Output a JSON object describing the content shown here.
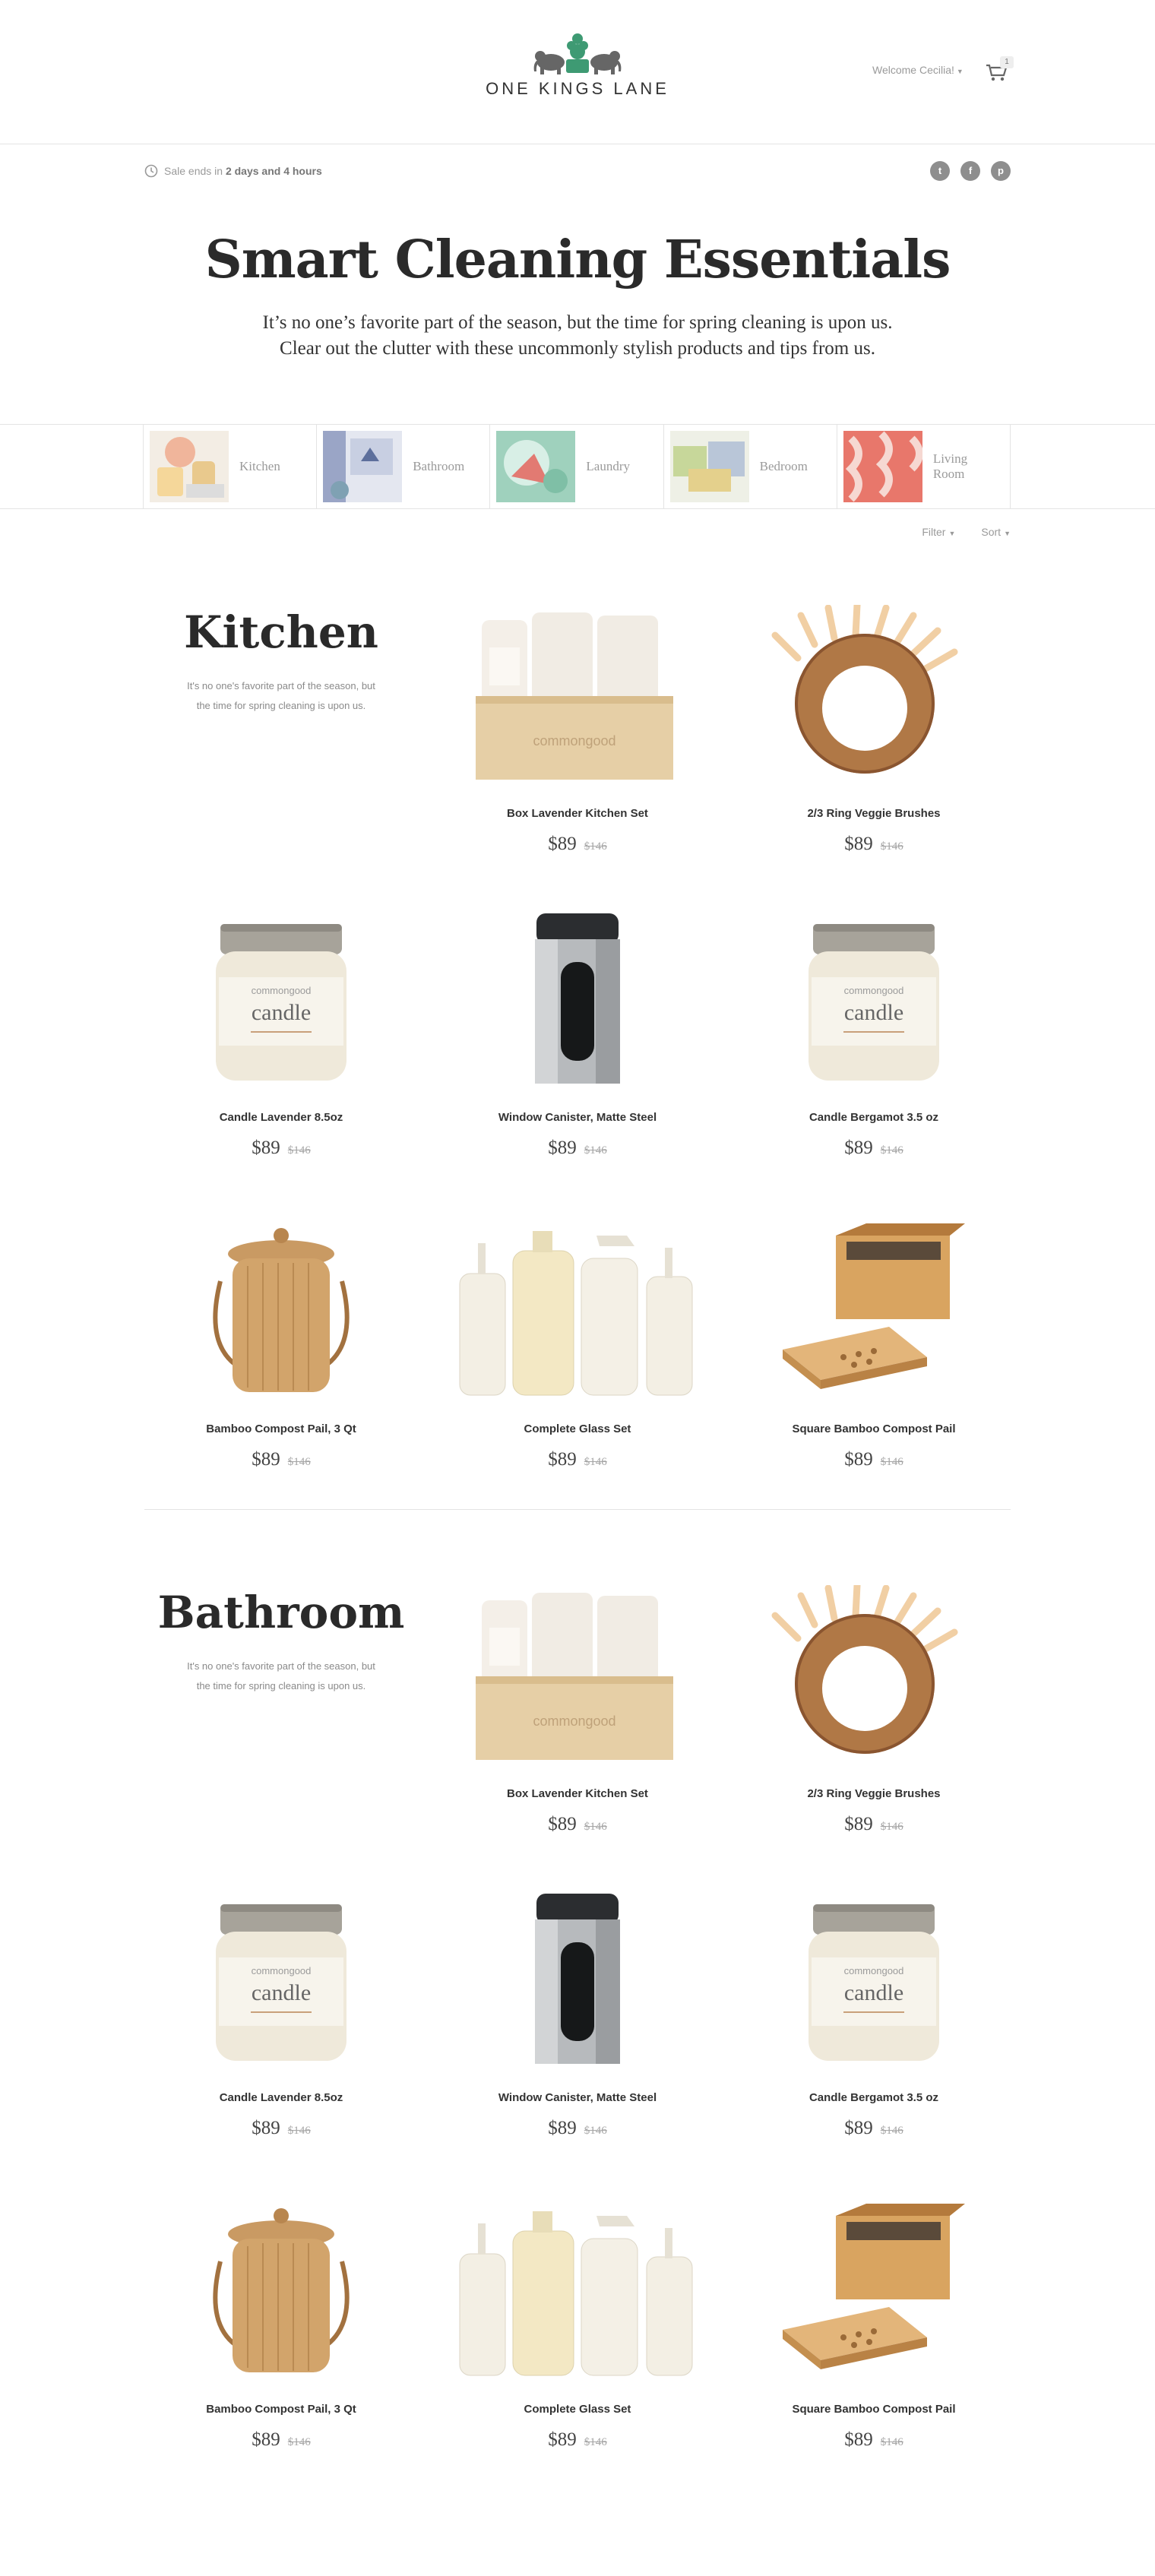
{
  "brand": {
    "name": "ONE KINGS LANE"
  },
  "header": {
    "welcome": "Welcome Cecilia!",
    "cart_count": "1"
  },
  "sale": {
    "prefix": "Sale ends in",
    "time": "2 days and 4 hours"
  },
  "social": {
    "twitter": "t",
    "facebook": "f",
    "pinterest": "p"
  },
  "hero": {
    "title": "Smart Cleaning Essentials",
    "line1": "It’s no one’s favorite part of the season, but the time for spring cleaning is upon us.",
    "line2": "Clear out the clutter with these uncommonly stylish products and tips from us."
  },
  "categories": [
    {
      "label": "Kitchen"
    },
    {
      "label": "Bathroom"
    },
    {
      "label": "Laundry"
    },
    {
      "label": "Bedroom"
    },
    {
      "label_line1": "Living",
      "label_line2": "Room"
    }
  ],
  "filters": {
    "filter": "Filter",
    "sort": "Sort"
  },
  "sections": [
    {
      "title": "Kitchen",
      "desc_line1": "It's no one's favorite part of the season, but",
      "desc_line2": "the time for spring cleaning is upon us.",
      "products": [
        {
          "name": "Box Lavender Kitchen Set",
          "price": "$89",
          "was": "$146",
          "icon": "box-set"
        },
        {
          "name": "2/3 Ring Veggie Brushes",
          "price": "$89",
          "was": "$146",
          "icon": "ring-brush"
        },
        {
          "name": "Candle Lavender 8.5oz",
          "price": "$89",
          "was": "$146",
          "icon": "candle"
        },
        {
          "name": "Window Canister, Matte Steel",
          "price": "$89",
          "was": "$146",
          "icon": "canister"
        },
        {
          "name": "Candle Bergamot 3.5 oz",
          "price": "$89",
          "was": "$146",
          "icon": "candle"
        },
        {
          "name": "Bamboo Compost Pail, 3 Qt",
          "price": "$89",
          "was": "$146",
          "icon": "pail"
        },
        {
          "name": "Complete Glass Set",
          "price": "$89",
          "was": "$146",
          "icon": "glass-set"
        },
        {
          "name": "Square Bamboo Compost Pail",
          "price": "$89",
          "was": "$146",
          "icon": "square-pail"
        }
      ]
    },
    {
      "title": "Bathroom",
      "desc_line1": "It's no one's favorite part of the season, but",
      "desc_line2": "the time for spring cleaning is upon us.",
      "products": [
        {
          "name": "Box Lavender Kitchen Set",
          "price": "$89",
          "was": "$146",
          "icon": "box-set"
        },
        {
          "name": "2/3 Ring Veggie Brushes",
          "price": "$89",
          "was": "$146",
          "icon": "ring-brush"
        },
        {
          "name": "Candle Lavender 8.5oz",
          "price": "$89",
          "was": "$146",
          "icon": "candle"
        },
        {
          "name": "Window Canister, Matte Steel",
          "price": "$89",
          "was": "$146",
          "icon": "canister"
        },
        {
          "name": "Candle Bergamot 3.5 oz",
          "price": "$89",
          "was": "$146",
          "icon": "candle"
        },
        {
          "name": "Bamboo Compost Pail, 3 Qt",
          "price": "$89",
          "was": "$146",
          "icon": "pail"
        },
        {
          "name": "Complete Glass Set",
          "price": "$89",
          "was": "$146",
          "icon": "glass-set"
        },
        {
          "name": "Square Bamboo Compost Pail",
          "price": "$89",
          "was": "$146",
          "icon": "square-pail"
        }
      ]
    }
  ]
}
